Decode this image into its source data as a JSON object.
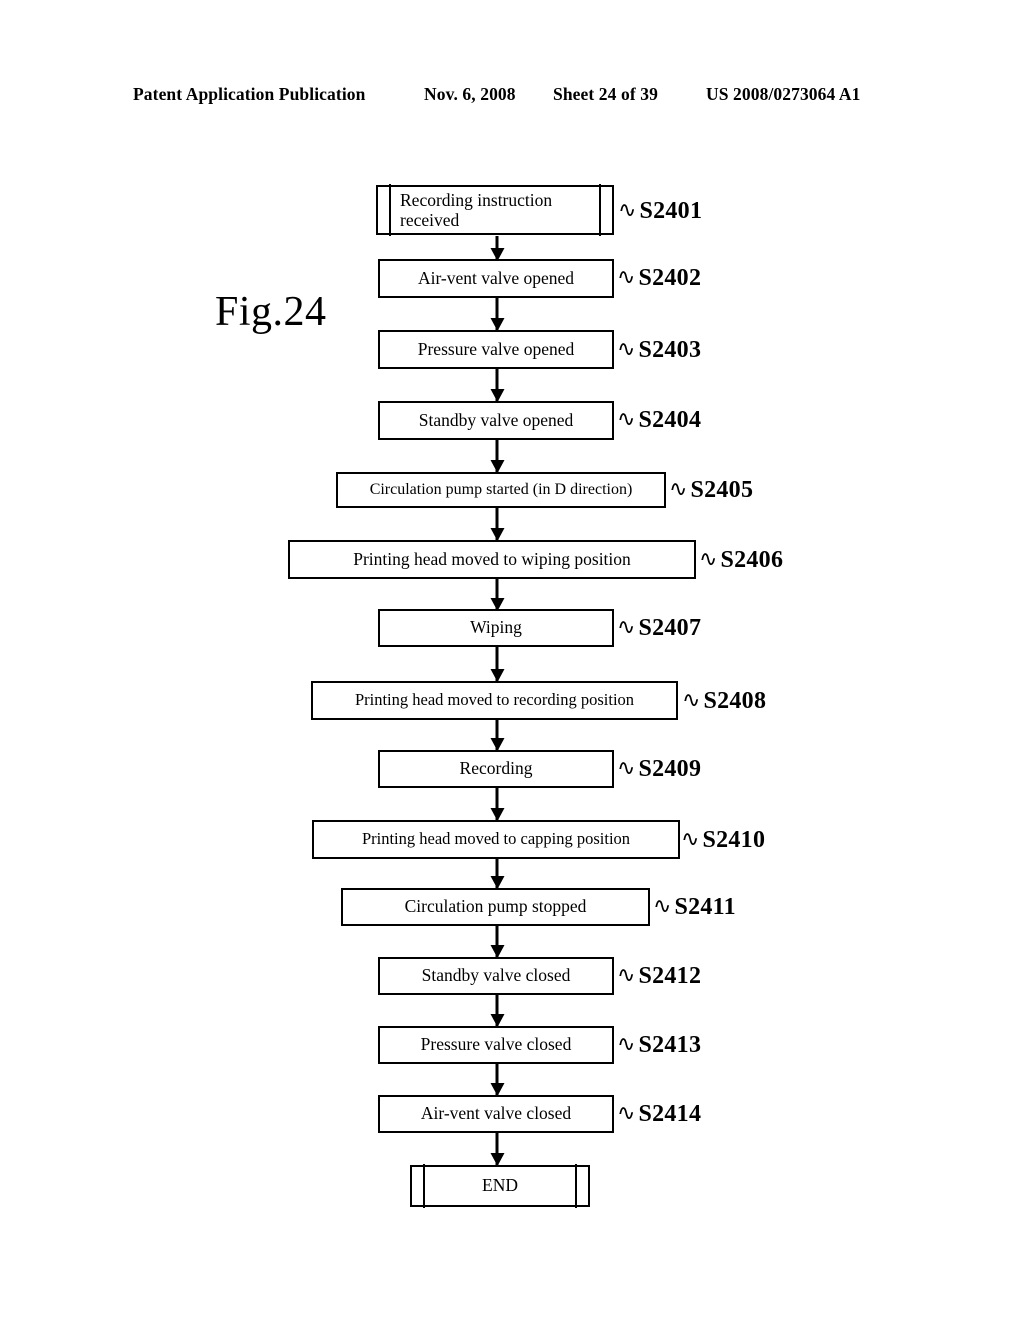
{
  "header": {
    "publication": "Patent Application Publication",
    "date": "Nov. 6, 2008",
    "sheet": "Sheet 24 of 39",
    "patent_number": "US 2008/0273064 A1"
  },
  "figure": {
    "label": "Fig.24"
  },
  "flowchart": {
    "nodes": [
      {
        "id": "s2401",
        "text": "Recording instruction received",
        "step": "S2401",
        "shape": "terminal"
      },
      {
        "id": "s2402",
        "text": "Air-vent valve opened",
        "step": "S2402",
        "shape": "process"
      },
      {
        "id": "s2403",
        "text": "Pressure valve opened",
        "step": "S2403",
        "shape": "process"
      },
      {
        "id": "s2404",
        "text": "Standby valve opened",
        "step": "S2404",
        "shape": "process"
      },
      {
        "id": "s2405",
        "text": "Circulation pump started (in D direction)",
        "step": "S2405",
        "shape": "process"
      },
      {
        "id": "s2406",
        "text": "Printing head moved to wiping position",
        "step": "S2406",
        "shape": "process"
      },
      {
        "id": "s2407",
        "text": "Wiping",
        "step": "S2407",
        "shape": "process"
      },
      {
        "id": "s2408",
        "text": "Printing head moved to recording position",
        "step": "S2408",
        "shape": "process"
      },
      {
        "id": "s2409",
        "text": "Recording",
        "step": "S2409",
        "shape": "process"
      },
      {
        "id": "s2410",
        "text": "Printing head moved to capping position",
        "step": "S2410",
        "shape": "process"
      },
      {
        "id": "s2411",
        "text": "Circulation pump stopped",
        "step": "S2411",
        "shape": "process"
      },
      {
        "id": "s2412",
        "text": "Standby valve closed",
        "step": "S2412",
        "shape": "process"
      },
      {
        "id": "s2413",
        "text": "Pressure valve closed",
        "step": "S2413",
        "shape": "process"
      },
      {
        "id": "s2414",
        "text": "Air-vent valve closed",
        "step": "S2414",
        "shape": "process"
      },
      {
        "id": "end",
        "text": "END",
        "step": "",
        "shape": "terminal"
      }
    ],
    "connector_symbol": "∿",
    "arrow_direction": "down"
  }
}
